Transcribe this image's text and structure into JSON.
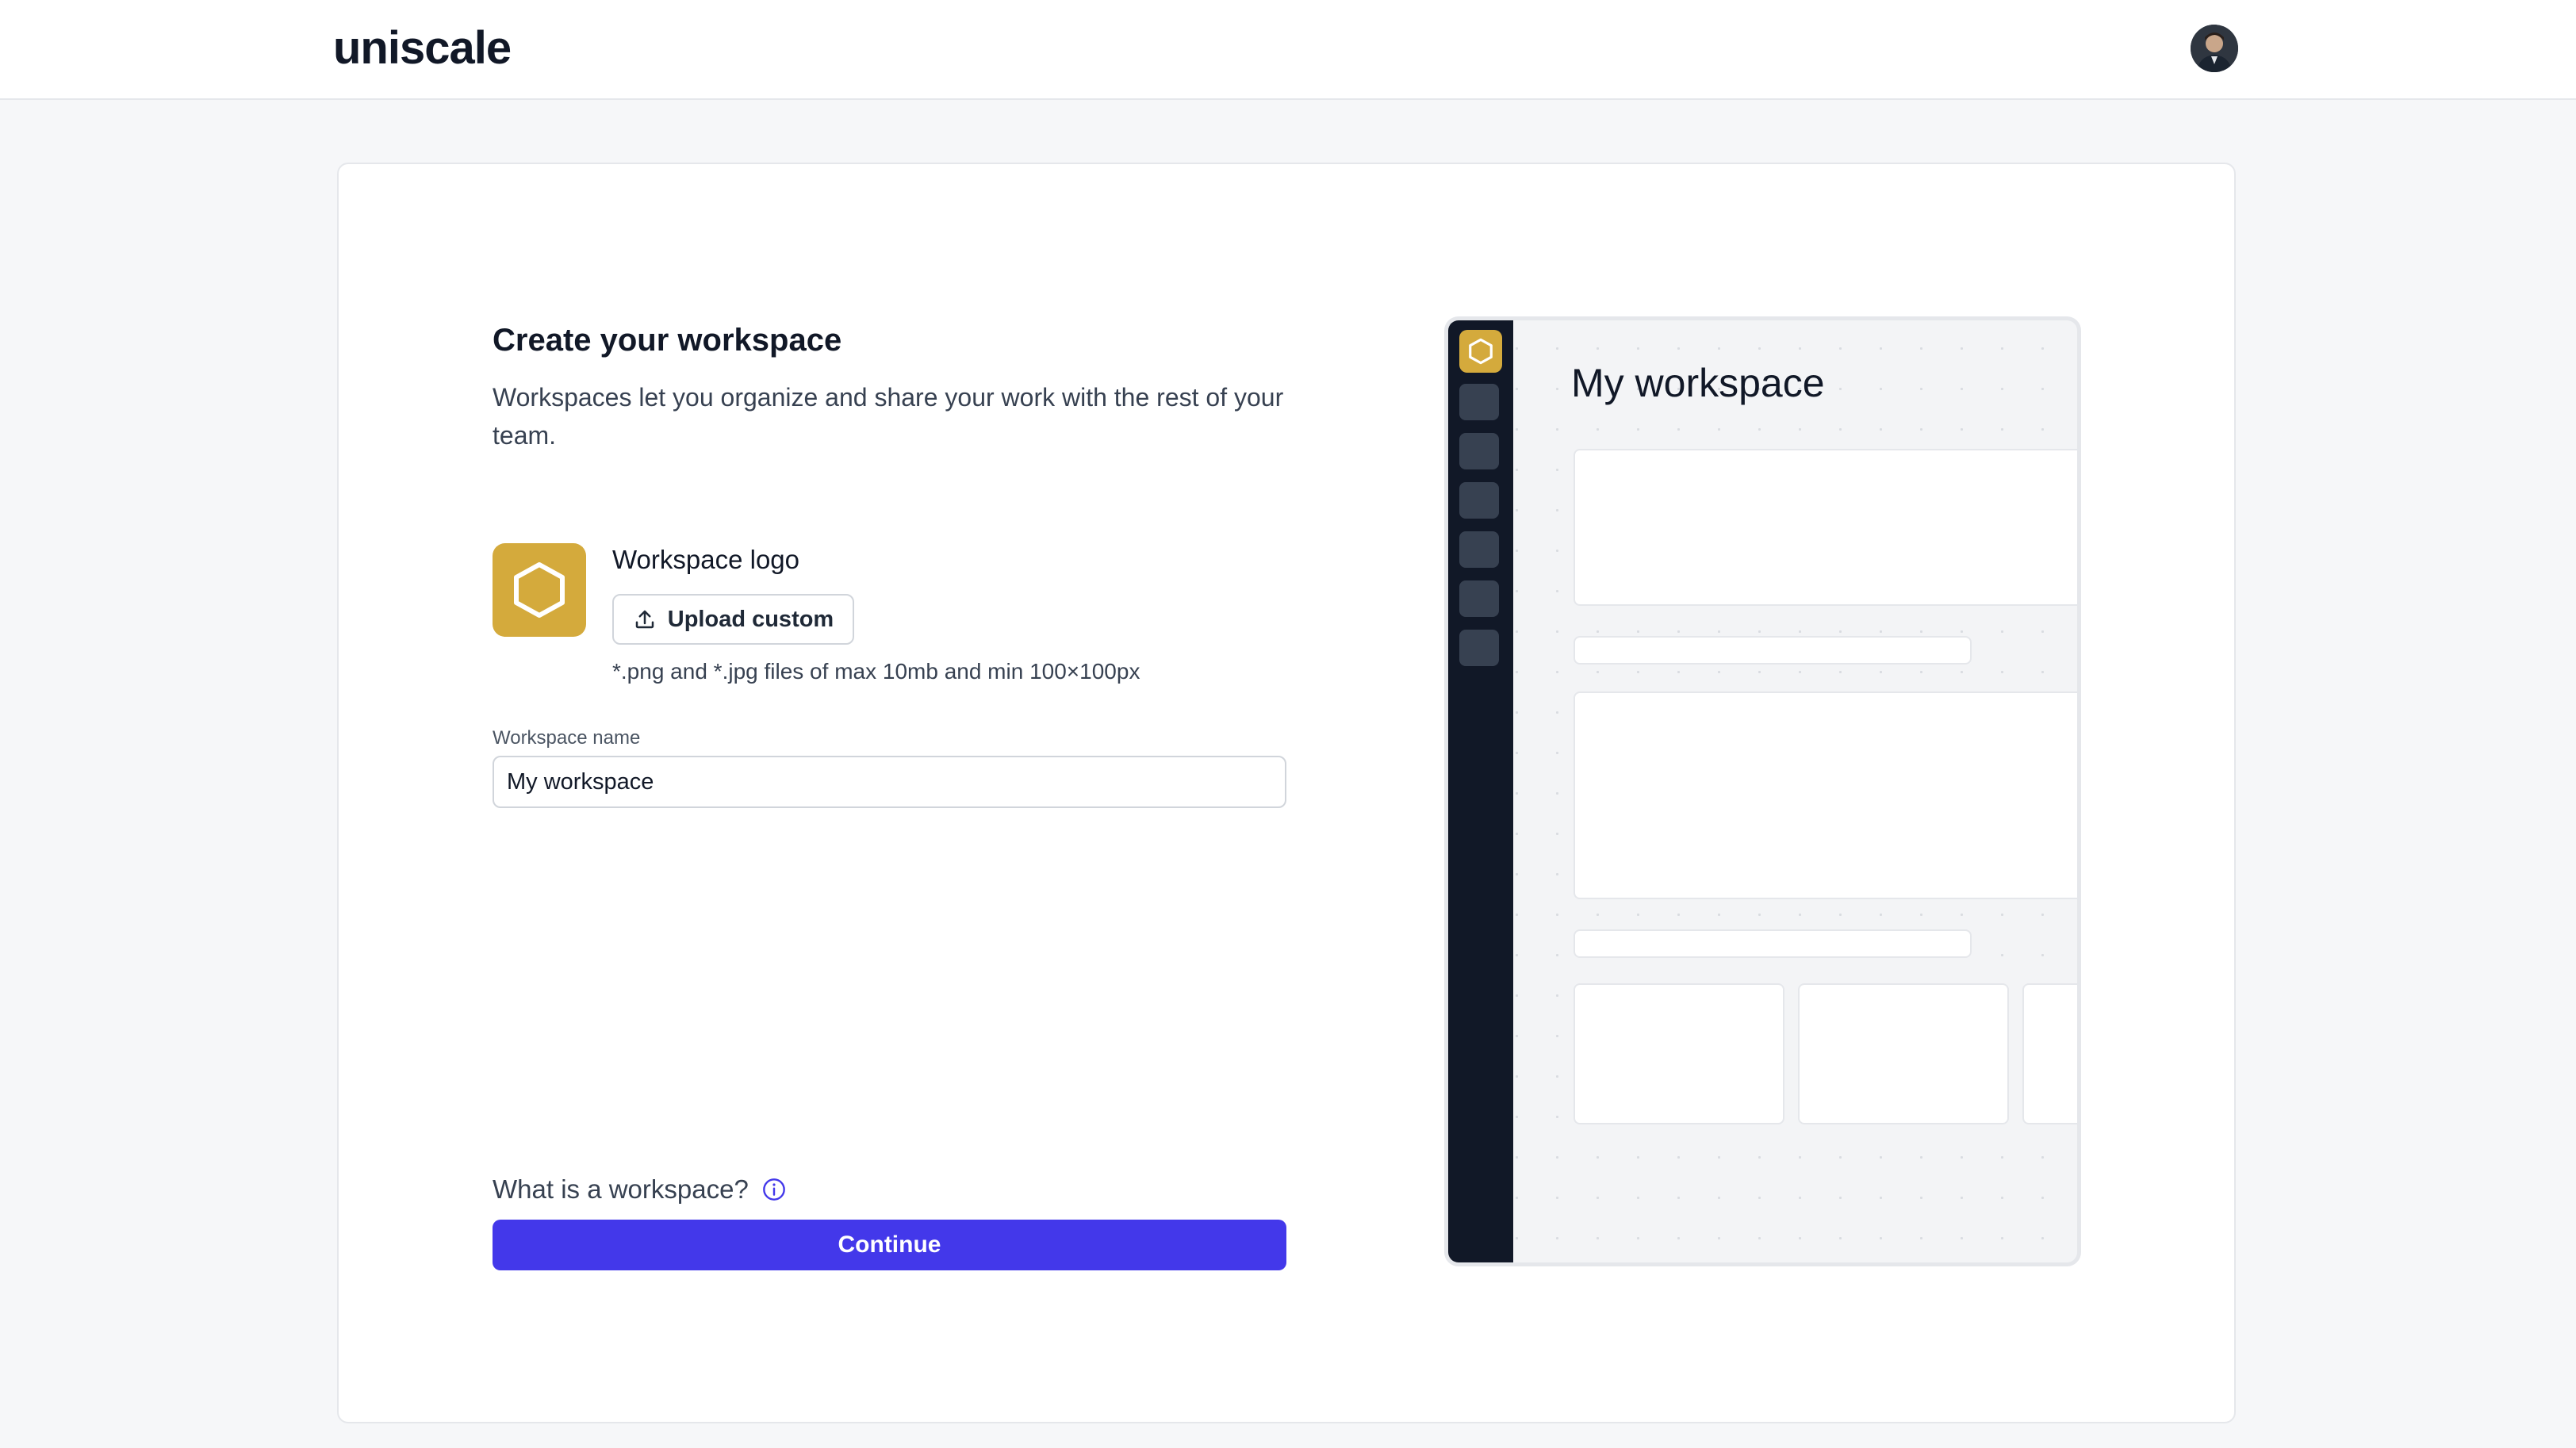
{
  "header": {
    "brand": "uniscale",
    "avatar_alt": "User avatar"
  },
  "form": {
    "title": "Create your workspace",
    "subtitle": "Workspaces let you organize and share your work with the rest of your team.",
    "logo_label": "Workspace logo",
    "upload_label": "Upload custom",
    "file_hint": "*.png and *.jpg files of max 10mb and min 100×100px",
    "name_label": "Workspace name",
    "name_value": "My workspace",
    "help_label": "What is a workspace?",
    "continue_label": "Continue"
  },
  "preview": {
    "title": "My workspace"
  },
  "colors": {
    "accent": "#4338ea",
    "logo_tile": "#d4aa3c",
    "sidebar": "#111827"
  },
  "icons": {
    "logo": "hexagon-icon",
    "upload": "upload-icon",
    "help": "info-icon"
  }
}
